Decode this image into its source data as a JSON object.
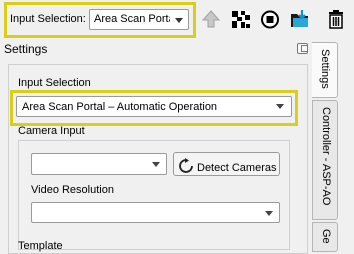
{
  "toolbar": {
    "input_selection_label": "Input Selection:",
    "input_selection_value": "Area Scan Portal",
    "icons": [
      "up-arrow-icon",
      "qr-pattern-icon",
      "stop-icon",
      "folder-download-icon",
      "trash-icon"
    ],
    "highlight_color": "#d9cf1a"
  },
  "panel": {
    "title": "Settings",
    "input_selection_group": "Input Selection",
    "input_selection_value": "Area Scan Portal – Automatic Operation",
    "camera_input_label": "Camera Input",
    "camera_select_value": "",
    "detect_cameras_label": "Detect Cameras",
    "video_resolution_label": "Video Resolution",
    "video_resolution_value": "",
    "next_section_label": "Template"
  },
  "tabs": [
    {
      "label": "Settings",
      "active": true
    },
    {
      "label": "Controller - ASP-AO",
      "active": false
    },
    {
      "label": "Ge",
      "active": false
    }
  ]
}
